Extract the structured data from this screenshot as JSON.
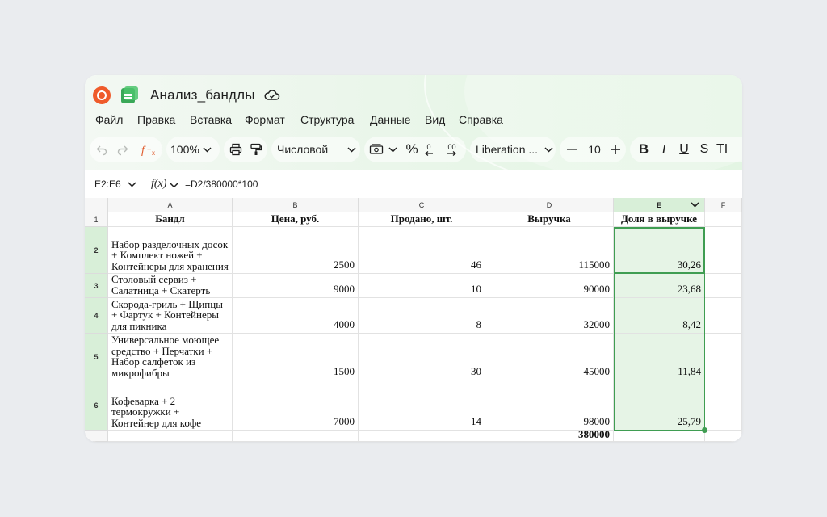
{
  "app": {
    "title": "Анализ_бандлы",
    "menu": [
      "Файл",
      "Правка",
      "Вставка",
      "Формат",
      "Структура",
      "Данные",
      "Вид",
      "Справка"
    ]
  },
  "toolbar": {
    "zoom": "100%",
    "number_format": "Числовой",
    "font": "Liberation ...",
    "font_size": "10",
    "percent": "%",
    "bold": "B",
    "italic": "I",
    "underline": "U",
    "strike": "S",
    "clear_format": "TI"
  },
  "formula_bar": {
    "name_box": "E2:E6",
    "fx": "f(x)",
    "formula": "=D2/380000*100"
  },
  "sheet": {
    "columns": [
      "A",
      "B",
      "C",
      "D",
      "E",
      "F"
    ],
    "rows": [
      "1",
      "2",
      "3",
      "4",
      "5",
      "6",
      ""
    ],
    "header": [
      "Бандл",
      "Цена, руб.",
      "Продано, шт.",
      "Выручка",
      "Доля в выручке"
    ],
    "data": [
      [
        "Набор разделочных досок + Комплект ножей + Контейнеры для хранения",
        "2500",
        "46",
        "115000",
        "30,26"
      ],
      [
        "Столовый сервиз + Салатница + Скатерть",
        "9000",
        "10",
        "90000",
        "23,68"
      ],
      [
        "Скорода-гриль + Щипцы + Фартук + Контейнеры для пикника",
        "4000",
        "8",
        "32000",
        "8,42"
      ],
      [
        "Универсальное моющее средство + Перчатки + Набор салфеток из микрофибры",
        "1500",
        "30",
        "45000",
        "11,84"
      ],
      [
        "Кофеварка + 2 термокружки + Контейнер для кофе",
        "7000",
        "14",
        "98000",
        "25,79"
      ]
    ],
    "total": "380000"
  },
  "colors": {
    "accent": "#3f9d52",
    "selection_fill": "#e6f4e6",
    "brand_logo": "#ef5b2b"
  }
}
